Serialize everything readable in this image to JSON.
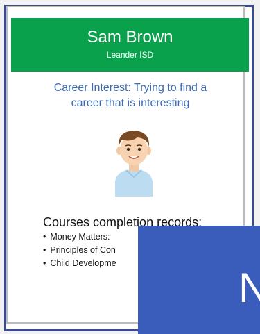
{
  "profile": {
    "name": "Sam Brown",
    "organization": "Leander ISD",
    "career_interest_line1": "Career Interest: Trying to find a",
    "career_interest_line2": "career that is interesting"
  },
  "courses": {
    "title": "Courses completion records:",
    "items": [
      "Money Matters:",
      "Principles of Con",
      "Child Developme"
    ]
  },
  "overlay": {
    "letter": "N"
  },
  "icons": {
    "avatar": "avatar-icon"
  },
  "colors": {
    "header_bg": "#0aa14d",
    "header_text": "#ffffff",
    "career_text": "#3c6ab0",
    "overlay_bg": "#3a5dbc",
    "frame": "#3a4a8e"
  }
}
